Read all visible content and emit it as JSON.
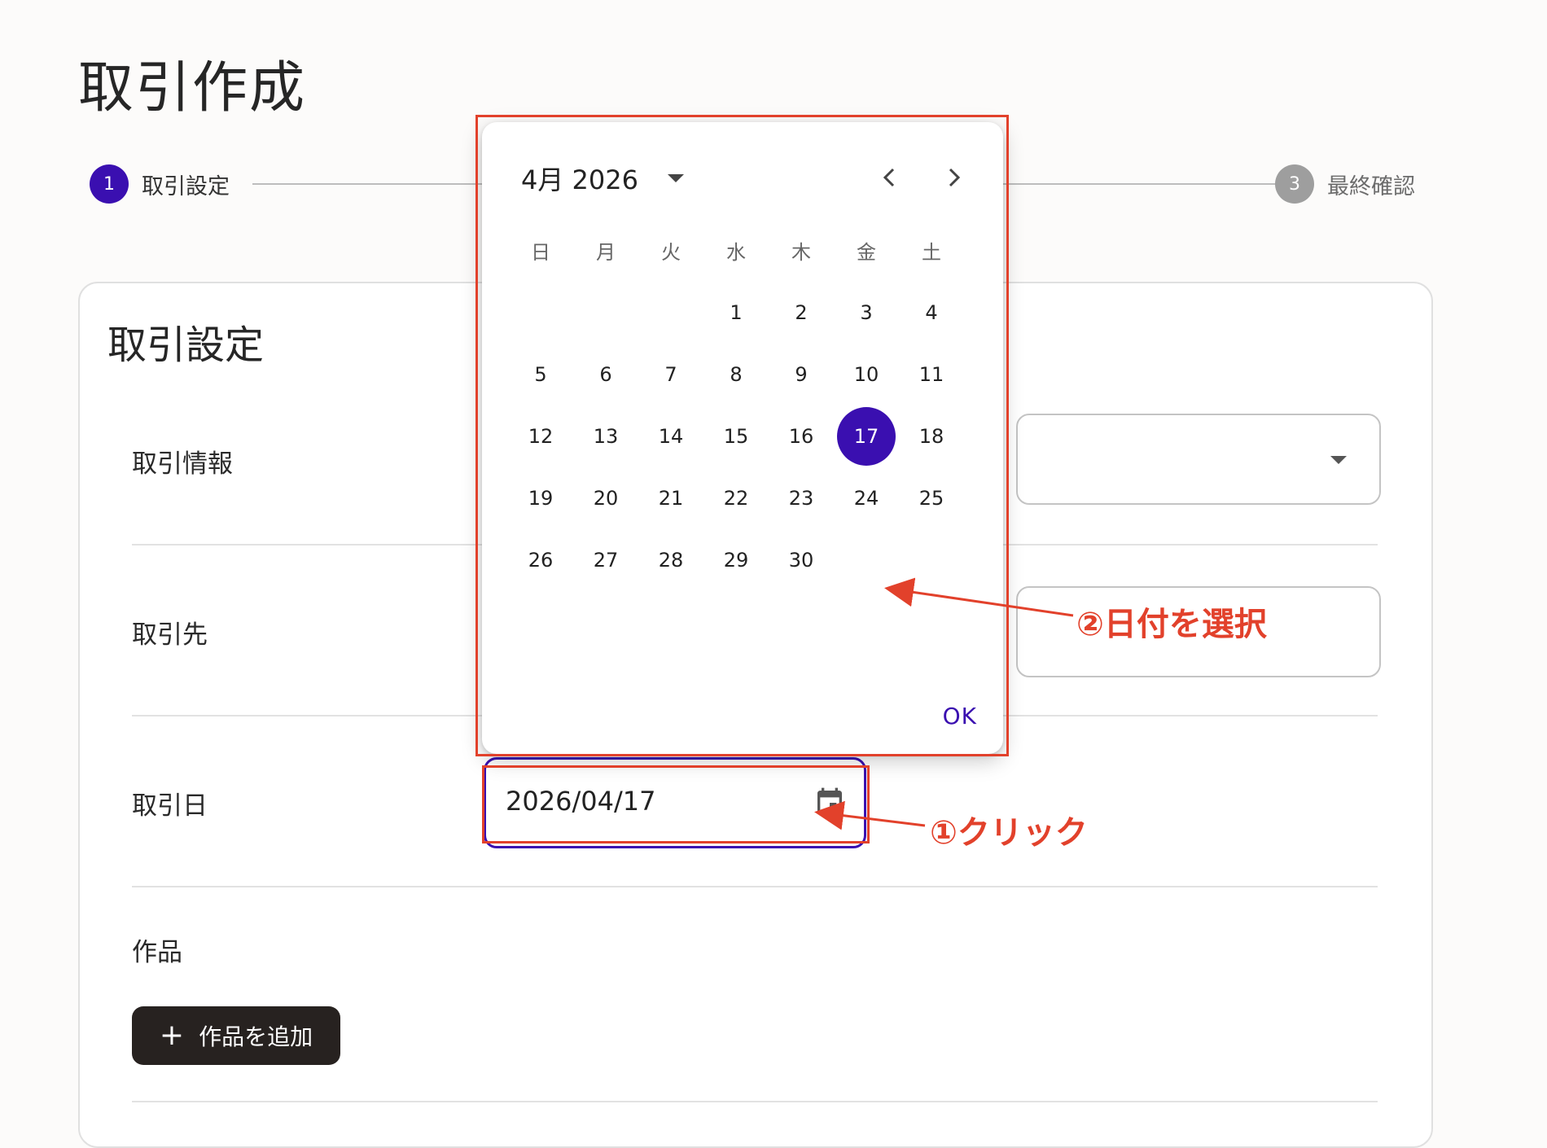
{
  "page": {
    "title": "取引作成"
  },
  "stepper": {
    "steps": [
      {
        "number": "1",
        "label": "取引設定"
      },
      {
        "number": "3",
        "label": "最終確認"
      }
    ],
    "active_color": "#3a0fb0",
    "inactive_color": "#9e9e9e"
  },
  "card": {
    "title": "取引設定",
    "rows": {
      "info_label": "取引情報",
      "partner_label": "取引先",
      "date_label": "取引日",
      "works_label": "作品"
    },
    "date_value": "2026/04/17",
    "add_work_label": "作品を追加",
    "add_work_icon": "plus-icon",
    "calendar_icon": "calendar-icon"
  },
  "date_picker": {
    "month_label": "4月 2026",
    "weekdays": [
      "日",
      "月",
      "火",
      "水",
      "木",
      "金",
      "土"
    ],
    "days": [
      "1",
      "2",
      "3",
      "4",
      "5",
      "6",
      "7",
      "8",
      "9",
      "10",
      "11",
      "12",
      "13",
      "14",
      "15",
      "16",
      "17",
      "18",
      "19",
      "20",
      "21",
      "22",
      "23",
      "24",
      "25",
      "26",
      "27",
      "28",
      "29",
      "30"
    ],
    "first_weekday_index": 3,
    "selected_day": "17",
    "ok_label": "OK",
    "prev_icon": "chevron-left-icon",
    "next_icon": "chevron-right-icon",
    "accent": "#3a0fb0"
  },
  "annotations": {
    "click_note": "①クリック",
    "select_note": "②日付を選択",
    "color": "#e2412b"
  }
}
